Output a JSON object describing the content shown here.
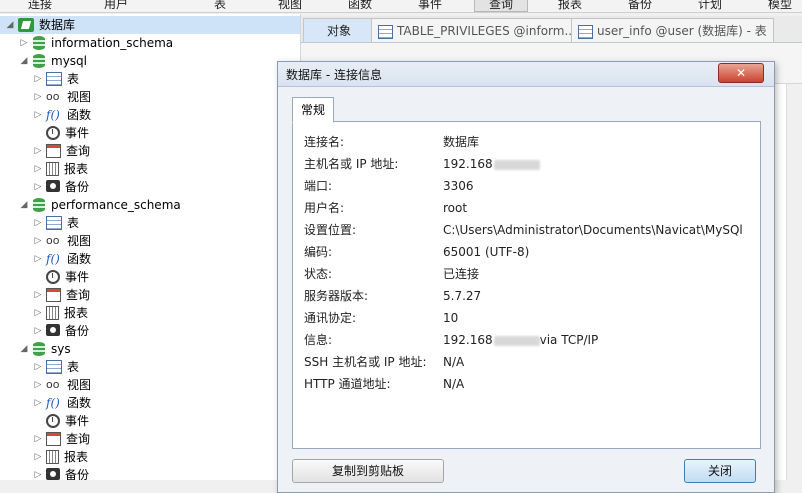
{
  "menu": [
    "连接",
    "用户",
    "表",
    "视图",
    "函数",
    "事件",
    "查询",
    "报表",
    "备份",
    "计划",
    "模型"
  ],
  "menu_active": "查询",
  "tree": [
    {
      "label": "数据库",
      "icon": "connection-icon",
      "level": 0,
      "expanded": true,
      "selected": true
    },
    {
      "label": "information_schema",
      "icon": "database-icon",
      "level": 1,
      "expanded": false
    },
    {
      "label": "mysql",
      "icon": "database-icon",
      "level": 1,
      "expanded": true
    },
    {
      "label": "表",
      "icon": "table-icon",
      "level": 2
    },
    {
      "label": "视图",
      "icon": "view-icon",
      "level": 2
    },
    {
      "label": "函数",
      "icon": "function-icon",
      "level": 2
    },
    {
      "label": "事件",
      "icon": "event-icon",
      "level": 2
    },
    {
      "label": "查询",
      "icon": "query-icon",
      "level": 2
    },
    {
      "label": "报表",
      "icon": "report-icon",
      "level": 2
    },
    {
      "label": "备份",
      "icon": "backup-icon",
      "level": 2
    },
    {
      "label": "performance_schema",
      "icon": "database-icon",
      "level": 1,
      "expanded": true
    },
    {
      "label": "表",
      "icon": "table-icon",
      "level": 2
    },
    {
      "label": "视图",
      "icon": "view-icon",
      "level": 2
    },
    {
      "label": "函数",
      "icon": "function-icon",
      "level": 2
    },
    {
      "label": "事件",
      "icon": "event-icon",
      "level": 2
    },
    {
      "label": "查询",
      "icon": "query-icon",
      "level": 2
    },
    {
      "label": "报表",
      "icon": "report-icon",
      "level": 2
    },
    {
      "label": "备份",
      "icon": "backup-icon",
      "level": 2
    },
    {
      "label": "sys",
      "icon": "database-icon",
      "level": 1,
      "expanded": true
    },
    {
      "label": "表",
      "icon": "table-icon",
      "level": 2
    },
    {
      "label": "视图",
      "icon": "view-icon",
      "level": 2
    },
    {
      "label": "函数",
      "icon": "function-icon",
      "level": 2
    },
    {
      "label": "事件",
      "icon": "event-icon",
      "level": 2
    },
    {
      "label": "查询",
      "icon": "query-icon",
      "level": 2
    },
    {
      "label": "报表",
      "icon": "report-icon",
      "level": 2
    },
    {
      "label": "备份",
      "icon": "backup-icon",
      "level": 2
    }
  ],
  "tabs": {
    "objects": "对象",
    "tab1": "TABLE_PRIVILEGES @inform...",
    "tab2": "user_info @user (数据库) - 表"
  },
  "dialog": {
    "title": "数据库 - 连接信息",
    "close_glyph": "✕",
    "tab": "常规",
    "fields": [
      {
        "label": "连接名:",
        "value": "数据库"
      },
      {
        "label": "主机名或 IP 地址:",
        "value": "192.168",
        "redacted": true
      },
      {
        "label": "端口:",
        "value": "3306"
      },
      {
        "label": "用户名:",
        "value": "root"
      },
      {
        "label": "设置位置:",
        "value": "C:\\Users\\Administrator\\Documents\\Navicat\\MySQl"
      },
      {
        "label": "编码:",
        "value": "65001 (UTF-8)"
      },
      {
        "label": "状态:",
        "value": "已连接"
      },
      {
        "label": "服务器版本:",
        "value": "5.7.27"
      },
      {
        "label": "通讯协定:",
        "value": "10"
      },
      {
        "label": "信息:",
        "value": "192.168",
        "redacted": true,
        "suffix": "via TCP/IP"
      },
      {
        "label": "SSH 主机名或 IP 地址:",
        "value": "N/A"
      },
      {
        "label": "HTTP 通道地址:",
        "value": "N/A"
      }
    ],
    "copy_button": "复制到剪贴板",
    "close_button": "关闭"
  },
  "colors": {
    "selection": "#cfe3f8",
    "dialog_close": "#c9442d",
    "db_icon": "#3fa24a"
  }
}
